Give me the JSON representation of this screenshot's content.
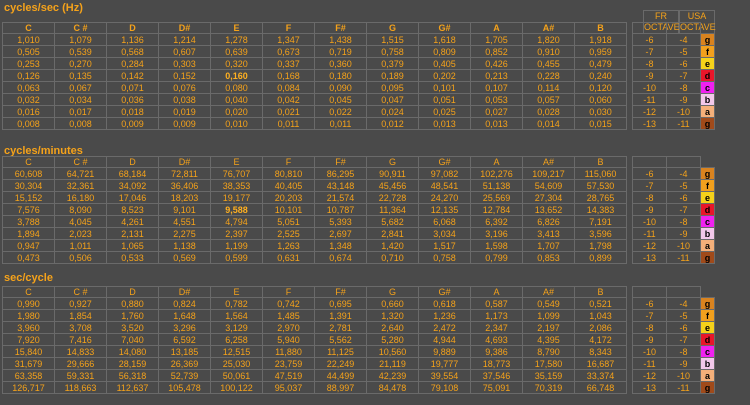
{
  "titles": {
    "t1": "cycles/sec (Hz)",
    "t2": "cycles/minutes",
    "t3": "sec/cycle"
  },
  "oct_header": {
    "fr": "FR OCTAVE",
    "usa": "USA OCTAVE"
  },
  "notes": [
    "C",
    "C #",
    "D",
    "D#",
    "E",
    "F",
    "F#",
    "G",
    "G#",
    "A",
    "A#",
    "B"
  ],
  "labels": [
    "g",
    "f",
    "e",
    "d",
    "c",
    "b",
    "a",
    "g"
  ],
  "label_colors": [
    "#d9831f",
    "#f2a01d",
    "#f5d21a",
    "#e8162a",
    "#f020f0",
    "#f2c8ea",
    "#f5b07a",
    "#a04a1a"
  ],
  "fr": [
    "-6",
    "-7",
    "-8",
    "-9",
    "-10",
    "-11",
    "-12",
    "-13"
  ],
  "usa": [
    "-4",
    "-5",
    "-6",
    "-7",
    "-8",
    "-9",
    "-10",
    "-11"
  ],
  "t1": [
    [
      "1,010",
      "1,079",
      "1,136",
      "1,214",
      "1,278",
      "1,347",
      "1,438",
      "1,515",
      "1,618",
      "1,705",
      "1,820",
      "1,918"
    ],
    [
      "0,505",
      "0,539",
      "0,568",
      "0,607",
      "0,639",
      "0,673",
      "0,719",
      "0,758",
      "0,809",
      "0,852",
      "0,910",
      "0,959"
    ],
    [
      "0,253",
      "0,270",
      "0,284",
      "0,303",
      "0,320",
      "0,337",
      "0,360",
      "0,379",
      "0,405",
      "0,426",
      "0,455",
      "0,479"
    ],
    [
      "0,126",
      "0,135",
      "0,142",
      "0,152",
      "0,160",
      "0,168",
      "0,180",
      "0,189",
      "0,202",
      "0,213",
      "0,228",
      "0,240"
    ],
    [
      "0,063",
      "0,067",
      "0,071",
      "0,076",
      "0,080",
      "0,084",
      "0,090",
      "0,095",
      "0,101",
      "0,107",
      "0,114",
      "0,120"
    ],
    [
      "0,032",
      "0,034",
      "0,036",
      "0,038",
      "0,040",
      "0,042",
      "0,045",
      "0,047",
      "0,051",
      "0,053",
      "0,057",
      "0,060"
    ],
    [
      "0,016",
      "0,017",
      "0,018",
      "0,019",
      "0,020",
      "0,021",
      "0,022",
      "0,024",
      "0,025",
      "0,027",
      "0,028",
      "0,030"
    ],
    [
      "0,008",
      "0,008",
      "0,009",
      "0,009",
      "0,010",
      "0,011",
      "0,011",
      "0,012",
      "0,013",
      "0,013",
      "0,014",
      "0,015"
    ]
  ],
  "t2": [
    [
      "60,608",
      "64,721",
      "68,184",
      "72,811",
      "76,707",
      "80,810",
      "86,295",
      "90,911",
      "97,082",
      "102,276",
      "109,217",
      "115,060"
    ],
    [
      "30,304",
      "32,361",
      "34,092",
      "36,406",
      "38,353",
      "40,405",
      "43,148",
      "45,456",
      "48,541",
      "51,138",
      "54,609",
      "57,530"
    ],
    [
      "15,152",
      "16,180",
      "17,046",
      "18,203",
      "19,177",
      "20,203",
      "21,574",
      "22,728",
      "24,270",
      "25,569",
      "27,304",
      "28,765"
    ],
    [
      "7,576",
      "8,090",
      "8,523",
      "9,101",
      "9,588",
      "10,101",
      "10,787",
      "11,364",
      "12,135",
      "12,784",
      "13,652",
      "14,383"
    ],
    [
      "3,788",
      "4,045",
      "4,261",
      "4,551",
      "4,794",
      "5,051",
      "5,393",
      "5,682",
      "6,068",
      "6,392",
      "6,826",
      "7,191"
    ],
    [
      "1,894",
      "2,023",
      "2,131",
      "2,275",
      "2,397",
      "2,525",
      "2,697",
      "2,841",
      "3,034",
      "3,196",
      "3,413",
      "3,596"
    ],
    [
      "0,947",
      "1,011",
      "1,065",
      "1,138",
      "1,199",
      "1,263",
      "1,348",
      "1,420",
      "1,517",
      "1,598",
      "1,707",
      "1,798"
    ],
    [
      "0,473",
      "0,506",
      "0,533",
      "0,569",
      "0,599",
      "0,631",
      "0,674",
      "0,710",
      "0,758",
      "0,799",
      "0,853",
      "0,899"
    ]
  ],
  "t3": [
    [
      "0,990",
      "0,927",
      "0,880",
      "0,824",
      "0,782",
      "0,742",
      "0,695",
      "0,660",
      "0,618",
      "0,587",
      "0,549",
      "0,521"
    ],
    [
      "1,980",
      "1,854",
      "1,760",
      "1,648",
      "1,564",
      "1,485",
      "1,391",
      "1,320",
      "1,236",
      "1,173",
      "1,099",
      "1,043"
    ],
    [
      "3,960",
      "3,708",
      "3,520",
      "3,296",
      "3,129",
      "2,970",
      "2,781",
      "2,640",
      "2,472",
      "2,347",
      "2,197",
      "2,086"
    ],
    [
      "7,920",
      "7,416",
      "7,040",
      "6,592",
      "6,258",
      "5,940",
      "5,562",
      "5,280",
      "4,944",
      "4,693",
      "4,395",
      "4,172"
    ],
    [
      "15,840",
      "14,833",
      "14,080",
      "13,185",
      "12,515",
      "11,880",
      "11,125",
      "10,560",
      "9,889",
      "9,386",
      "8,790",
      "8,343"
    ],
    [
      "31,679",
      "29,666",
      "28,159",
      "26,369",
      "25,030",
      "23,759",
      "22,249",
      "21,119",
      "19,777",
      "18,773",
      "17,580",
      "16,687"
    ],
    [
      "63,358",
      "59,331",
      "56,318",
      "52,739",
      "50,061",
      "47,519",
      "44,499",
      "42,239",
      "39,554",
      "37,546",
      "35,159",
      "33,374"
    ],
    [
      "126,717",
      "118,663",
      "112,637",
      "105,478",
      "100,122",
      "95,037",
      "88,997",
      "84,478",
      "79,108",
      "75,091",
      "70,319",
      "66,748"
    ]
  ]
}
